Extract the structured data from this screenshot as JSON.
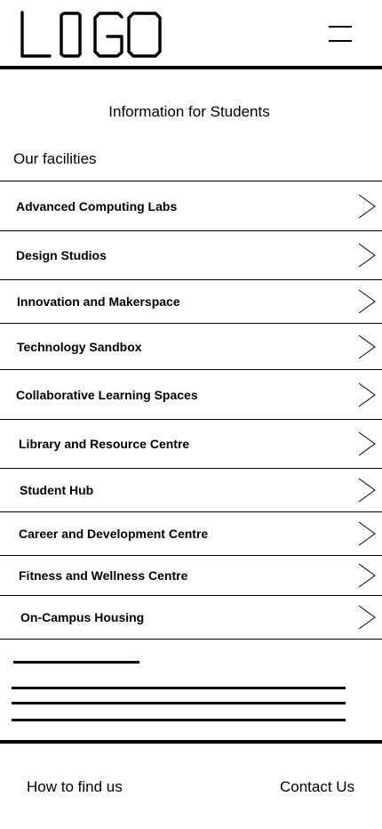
{
  "header": {
    "logo_text": "LOGO",
    "menu_icon": "hamburger-menu-icon"
  },
  "page": {
    "title": "Information for Students",
    "section_title": "Our facilities"
  },
  "facilities": [
    {
      "label": "Advanced Computing Labs"
    },
    {
      "label": "Design Studios"
    },
    {
      "label": "Innovation and Makerspace"
    },
    {
      "label": "Technology Sandbox"
    },
    {
      "label": "Collaborative Learning Spaces"
    },
    {
      "label": "Library and Resource Centre"
    },
    {
      "label": "Student Hub"
    },
    {
      "label": "Career and Development Centre"
    },
    {
      "label": "Fitness and Wellness Centre"
    },
    {
      "label": "On-Campus Housing"
    }
  ],
  "footer": {
    "find_us": "How to find us",
    "contact": "Contact Us"
  }
}
